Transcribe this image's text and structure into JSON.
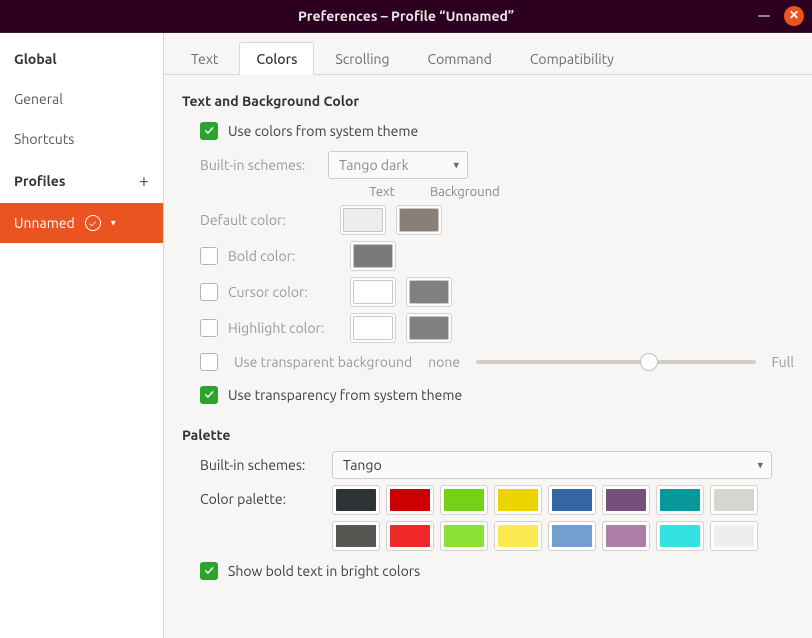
{
  "window": {
    "title": "Preferences – Profile “Unnamed”"
  },
  "sidebar": {
    "global_heading": "Global",
    "items": [
      "General",
      "Shortcuts"
    ],
    "profiles_heading": "Profiles",
    "profile_name": "Unnamed"
  },
  "tabs": [
    "Text",
    "Colors",
    "Scrolling",
    "Command",
    "Compatibility"
  ],
  "active_tab": 1,
  "text_bg": {
    "section": "Text and Background Color",
    "use_system": "Use colors from system theme",
    "builtin_label": "Built-in schemes:",
    "builtin_value": "Tango dark",
    "cols": {
      "text": "Text",
      "bg": "Background"
    },
    "rows": {
      "default": "Default color:",
      "bold": "Bold color:",
      "cursor": "Cursor color:",
      "highlight": "Highlight color:"
    },
    "swatches": {
      "default_text": "#ececec",
      "default_bg": "#888078",
      "bold_text": "#7a7a7a",
      "cursor_text": "#ffffff",
      "cursor_bg": "#808080",
      "highlight_text": "#ffffff",
      "highlight_bg": "#808080"
    },
    "transparent_bg": "Use transparent background",
    "slider_left": "none",
    "slider_right": "Full",
    "slider_value": 0.62,
    "use_sys_trans": "Use transparency from system theme"
  },
  "palette": {
    "section": "Palette",
    "builtin_label": "Built-in schemes:",
    "builtin_value": "Tango",
    "palette_label": "Color palette:",
    "colors": [
      "#2e3436",
      "#cc0000",
      "#73d216",
      "#edd400",
      "#3465a4",
      "#75507b",
      "#06989a",
      "#d3d7cf",
      "#555753",
      "#ef2929",
      "#8ae234",
      "#fce94f",
      "#729fcf",
      "#ad7fa8",
      "#34e2e2",
      "#eeeeec"
    ],
    "show_bold": "Show bold text in bright colors"
  }
}
